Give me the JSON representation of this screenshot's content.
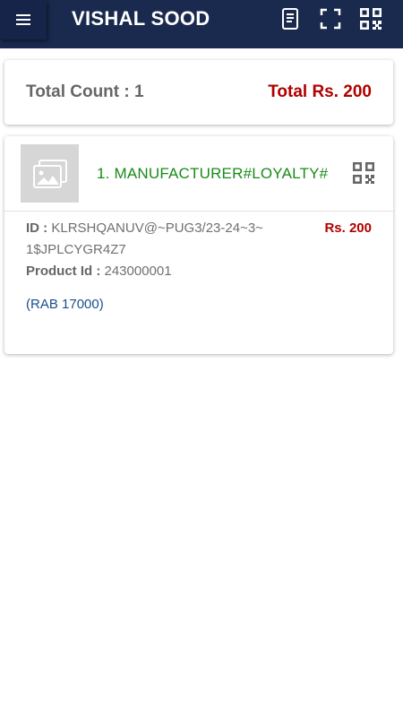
{
  "appbar": {
    "title": "VISHAL SOOD",
    "icons": [
      "menu-icon",
      "document-icon",
      "scan-frame-icon",
      "qr-code-icon"
    ],
    "background": "#1a2a4e"
  },
  "summary": {
    "count_label": "Total Count : 1",
    "total_label": "Total Rs. 200"
  },
  "items": [
    {
      "name": "1. MANUFACTURER#LOYALTY#",
      "id_label": "ID :",
      "id_value_line1": "KLRSHQANUV@~PUG3/23-24~3~",
      "id_value_line2": "1$JPLCYGR4Z7",
      "product_id_label": "Product Id :",
      "product_id_value": "243000001",
      "price": "Rs. 200",
      "note": "(RAB 17000)"
    }
  ],
  "colors": {
    "accent_red": "#b00000",
    "item_green": "#1a8a1a",
    "note_blue": "#1a4f8a"
  }
}
